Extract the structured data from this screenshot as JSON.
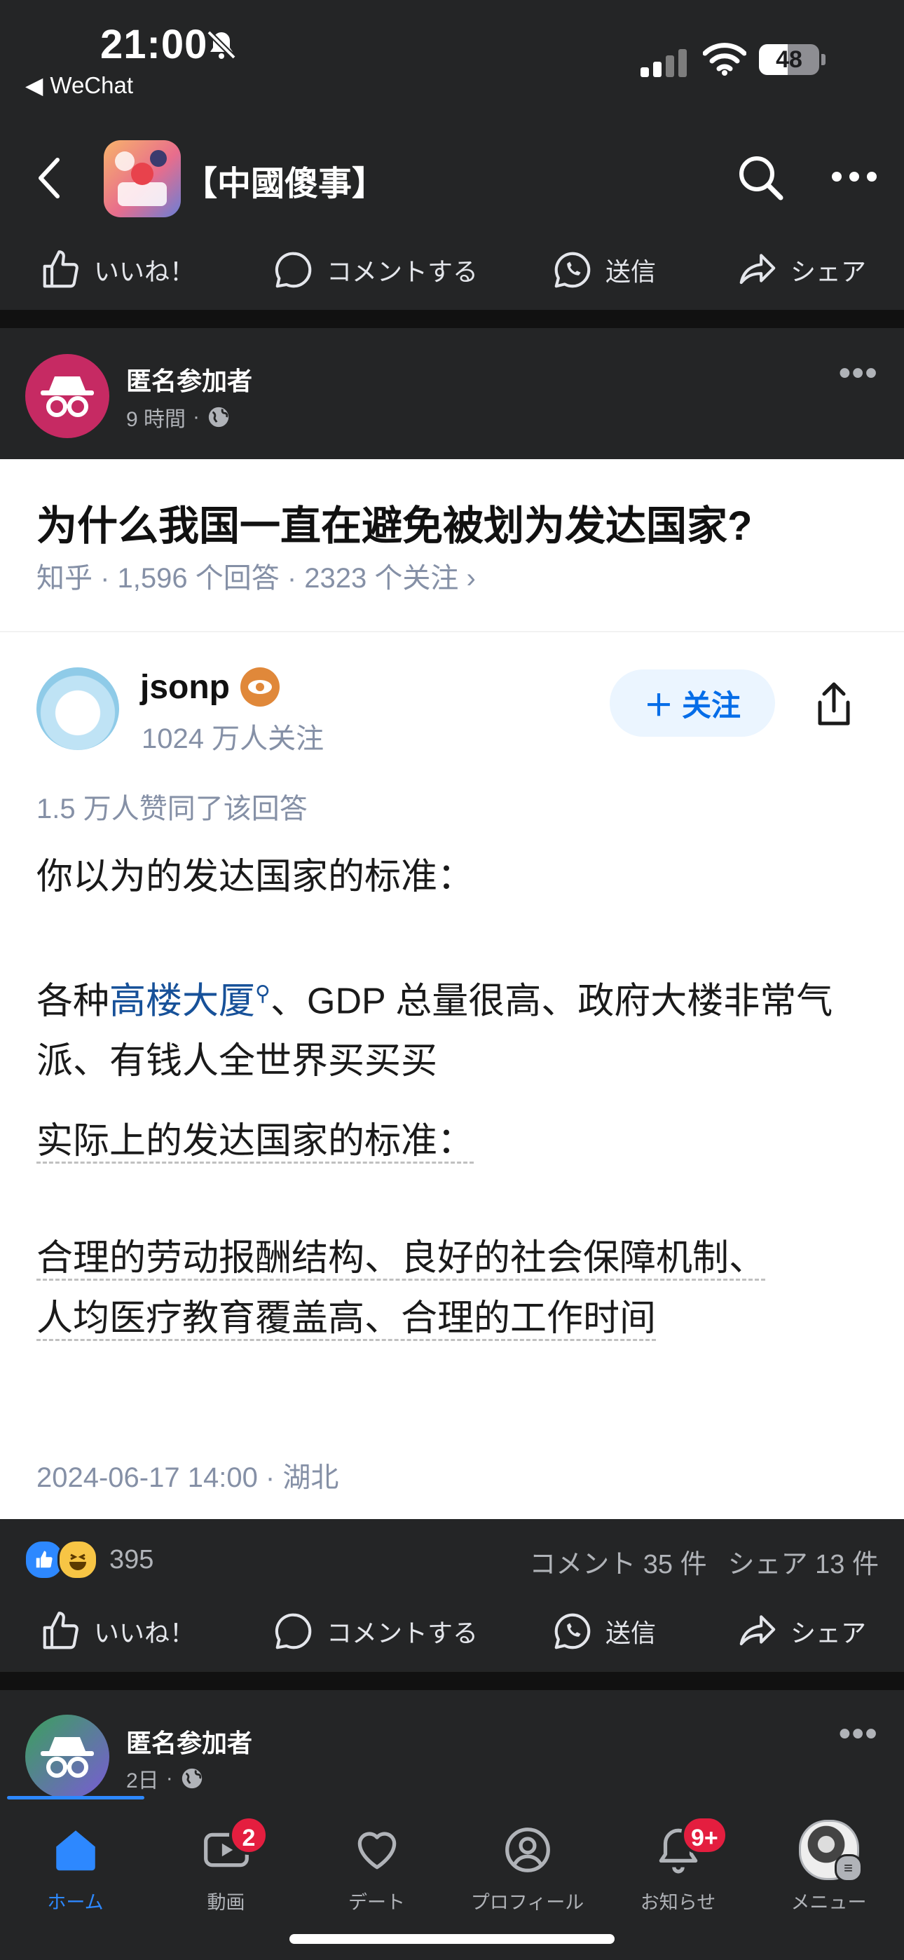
{
  "status_bar": {
    "time": "21:00",
    "back_app": "WeChat",
    "battery": "48"
  },
  "group": {
    "title": "【中國傻事】"
  },
  "actions": {
    "like": "いいね！",
    "comment": "コメントする",
    "send": "送信",
    "share": "シェア"
  },
  "post1": {
    "author": "匿名参加者",
    "time": "9 時間",
    "more": "•••",
    "card": {
      "question": "为什么我国一直在避免被划为发达国家?",
      "meta": "知乎 · 1,596 个回答 · 2323 个关注 ›",
      "answerer": "jsonp",
      "followers": "1024 万人关注",
      "follow_button": "关注",
      "votes": "1.5 万人赞同了该回答",
      "para1": "你以为的发达国家的标准：",
      "para2_pre": "各种",
      "para2_link": "高楼大厦",
      "para2_rest": "、GDP 总量很高、政府大楼非常气派、有钱人全世界买买买",
      "para3": "实际上的发达国家的标准：",
      "para4_line1": "合理的劳动报酬结构、良好的社会保障机制、",
      "para4_line2": "人均医疗教育覆盖高、合理的工作时间",
      "date": "2024-06-17 14:00 · 湖北"
    },
    "reactions_count": "395",
    "comments": "コメント 35 件",
    "shares": "シェア 13 件"
  },
  "post2": {
    "author": "匿名参加者",
    "time": "2日",
    "more": "•••"
  },
  "nav": {
    "home": "ホーム",
    "video": "動画",
    "video_badge": "2",
    "dating": "デート",
    "profile": "プロフィール",
    "notifications": "お知らせ",
    "notifications_badge": "9+",
    "menu": "メニュー"
  },
  "colors": {
    "background": "#242526",
    "accent": "#2d88ff",
    "badge": "#e41e3f",
    "zhihu_blue": "#056de8"
  }
}
